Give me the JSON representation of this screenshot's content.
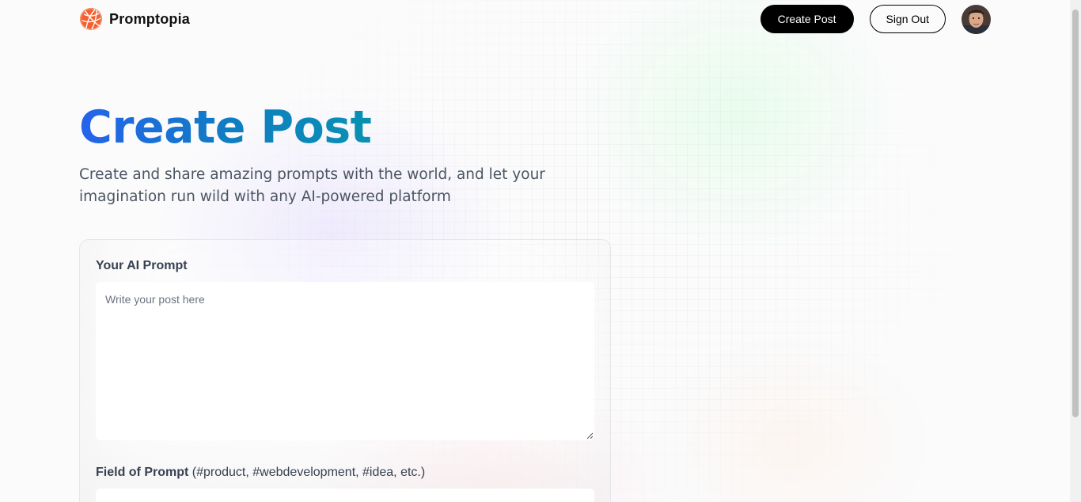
{
  "nav": {
    "brand_name": "Promptopia",
    "logo_icon": "globe-logo-icon",
    "create_post_label": "Create Post",
    "sign_out_label": "Sign Out",
    "avatar_icon": "user-avatar"
  },
  "hero": {
    "title": "Create Post",
    "description": "Create and share amazing prompts with the world, and let your imagination run wild with any AI-powered platform"
  },
  "form": {
    "prompt_label": "Your AI Prompt",
    "prompt_placeholder": "Write your post here",
    "prompt_value": "",
    "tag_label": "Field of Prompt",
    "tag_hint": "(#product, #webdevelopment, #idea, etc.)",
    "tag_value": ""
  },
  "colors": {
    "title_gradient_start": "#2563eb",
    "title_gradient_end": "#0891b2",
    "logo_orange": "#f3602d",
    "primary_button": "#000000",
    "text_muted": "#4b5563"
  }
}
